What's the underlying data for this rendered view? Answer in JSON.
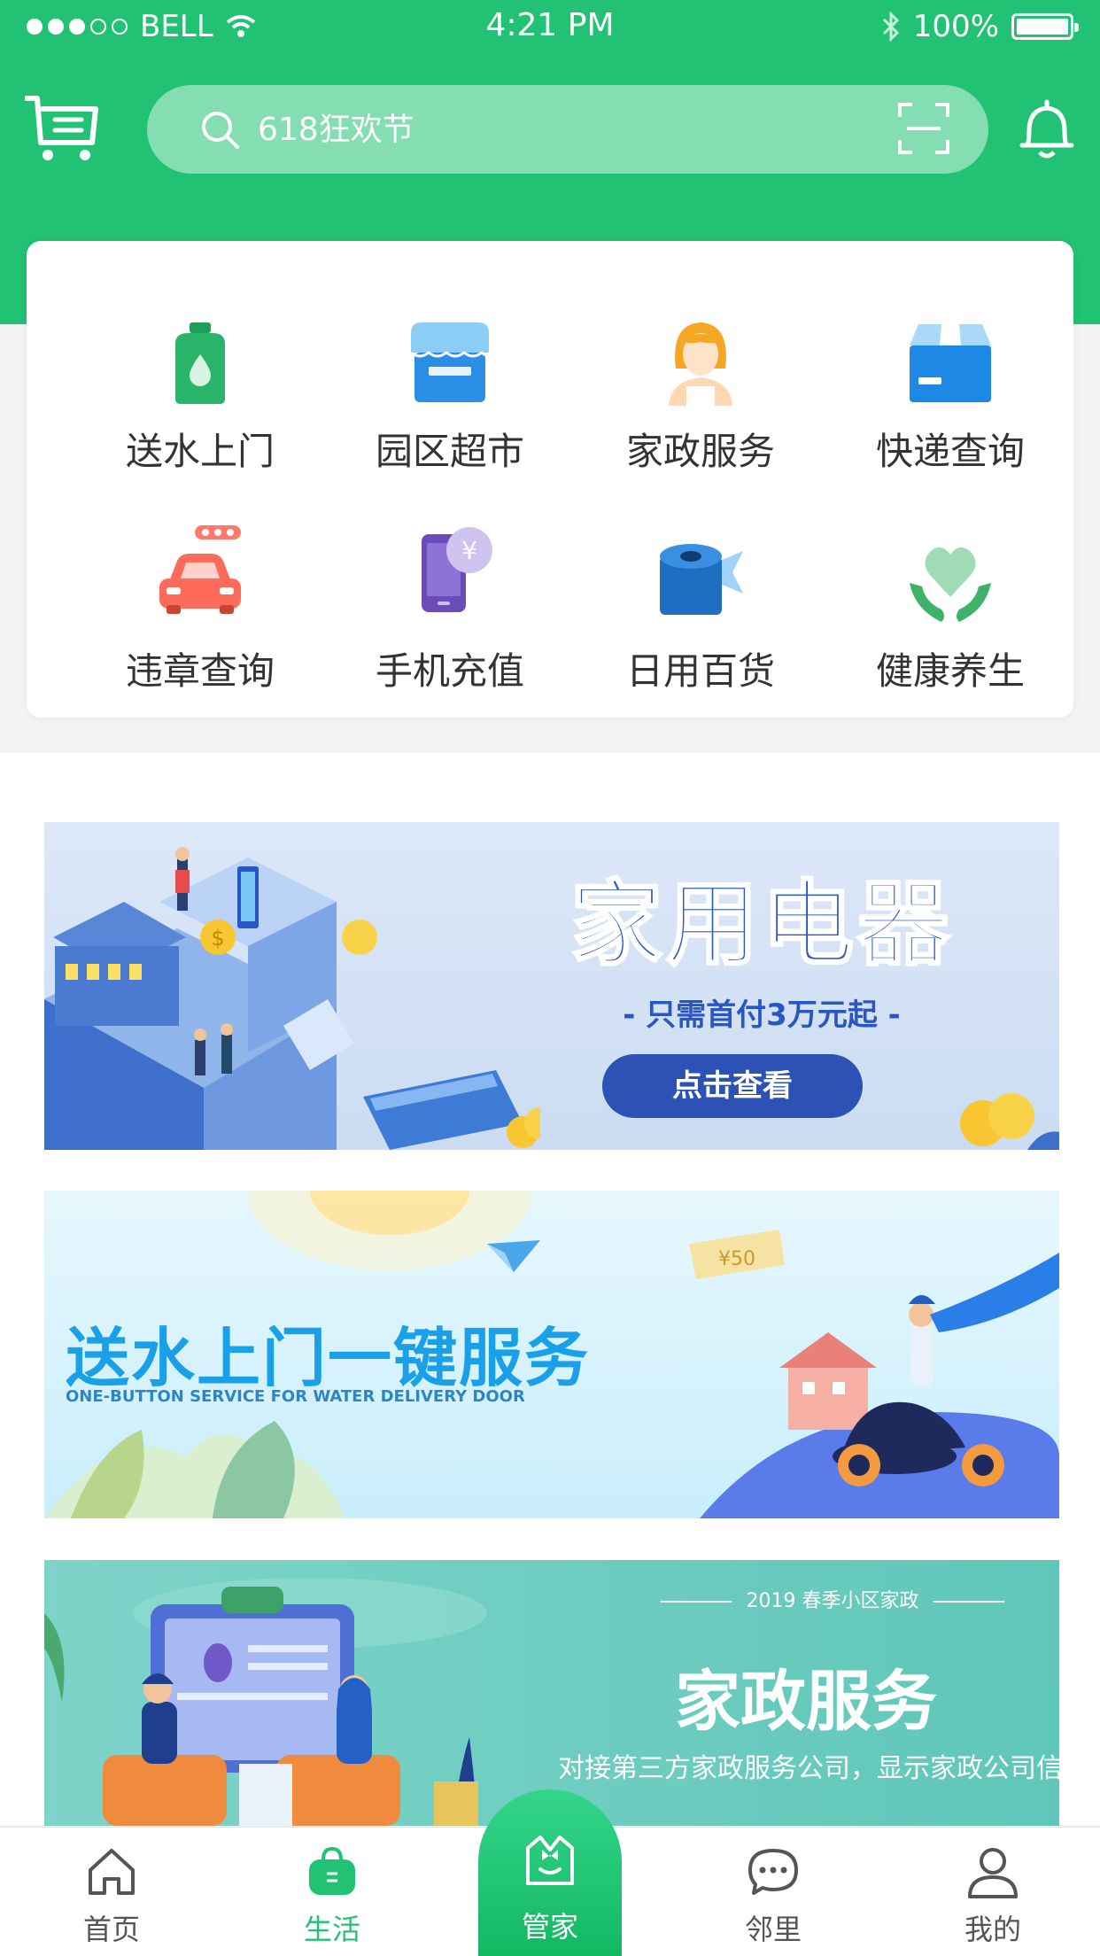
{
  "status_bar": {
    "carrier": "BELL",
    "time": "4:21 PM",
    "battery": "100%"
  },
  "search": {
    "placeholder": "618狂欢节"
  },
  "services": [
    {
      "label": "送水上门",
      "icon": "water-bottle-icon"
    },
    {
      "label": "园区超市",
      "icon": "store-icon"
    },
    {
      "label": "家政服务",
      "icon": "housekeeper-icon"
    },
    {
      "label": "快递查询",
      "icon": "package-icon"
    },
    {
      "label": "违章查询",
      "icon": "car-icon"
    },
    {
      "label": "手机充值",
      "icon": "phone-recharge-icon"
    },
    {
      "label": "日用百货",
      "icon": "tissue-roll-icon"
    },
    {
      "label": "健康养生",
      "icon": "heart-hands-icon"
    }
  ],
  "banners": {
    "appliances": {
      "title": "家用电器",
      "subtitle": "- 只需首付3万元起 -",
      "button": "点击查看"
    },
    "water": {
      "title": "送水上门一键服务",
      "subtitle": "ONE-BUTTON SERVICE FOR WATER DELIVERY DOOR"
    },
    "housekeeping": {
      "top": "2019 春季小区家政",
      "title": "家政服务",
      "subtitle": "对接第三方家政服务公司，显示家政公司信息"
    }
  },
  "tabs": [
    {
      "label": "首页",
      "icon": "home-icon"
    },
    {
      "label": "生活",
      "icon": "shopping-bag-icon"
    },
    {
      "label": "管家",
      "icon": "butler-icon"
    },
    {
      "label": "邻里",
      "icon": "chat-icon"
    },
    {
      "label": "我的",
      "icon": "user-icon"
    }
  ],
  "colors": {
    "brand_green": "#21c273",
    "banner_blue": "#2a55c4"
  }
}
